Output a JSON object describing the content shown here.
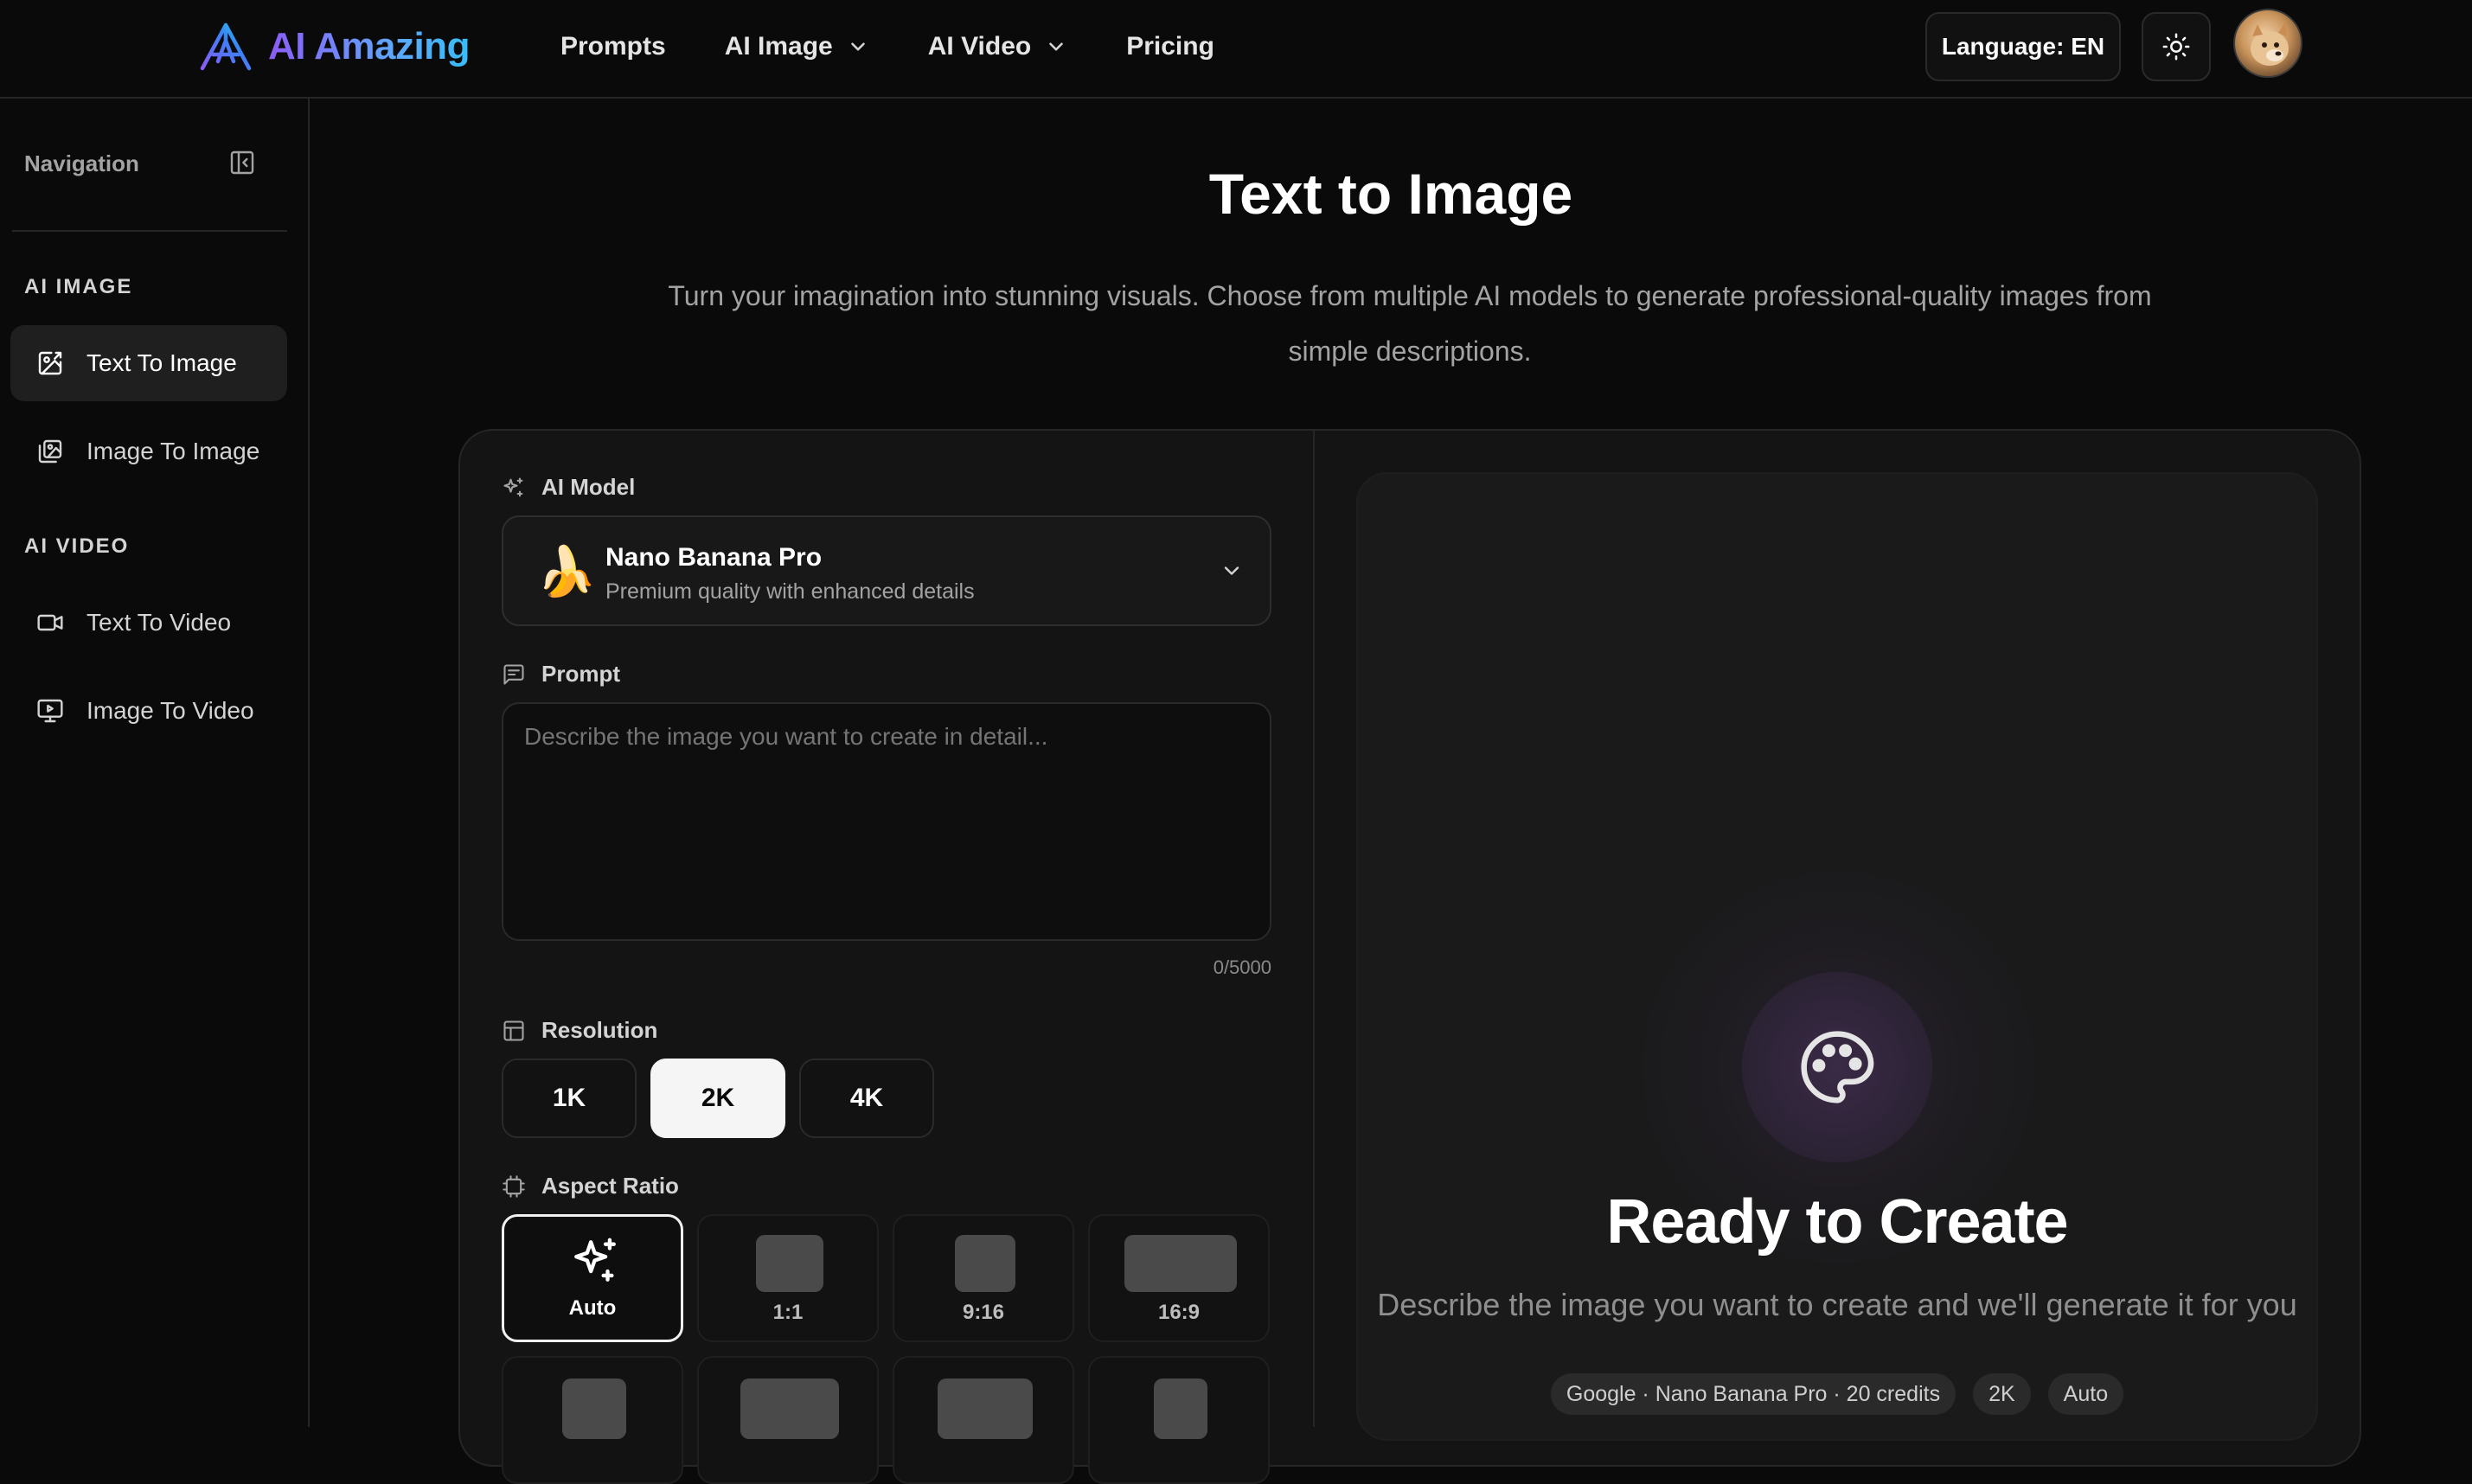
{
  "header": {
    "brand": "AI Amazing",
    "nav": [
      {
        "label": "Prompts",
        "has_dropdown": false
      },
      {
        "label": "AI Image",
        "has_dropdown": true
      },
      {
        "label": "AI Video",
        "has_dropdown": true
      },
      {
        "label": "Pricing",
        "has_dropdown": false
      }
    ],
    "language_button": "Language: EN",
    "theme_icon": "sun-icon",
    "avatar_icon": "user-avatar"
  },
  "sidebar": {
    "title": "Navigation",
    "collapse_icon": "sidebar-collapse-icon",
    "sections": [
      {
        "title": "AI IMAGE",
        "items": [
          {
            "label": "Text To Image",
            "icon": "image-edit-icon",
            "active": true
          },
          {
            "label": "Image To Image",
            "icon": "images-icon",
            "active": false
          }
        ]
      },
      {
        "title": "AI VIDEO",
        "items": [
          {
            "label": "Text To Video",
            "icon": "video-camera-icon",
            "active": false
          },
          {
            "label": "Image To Video",
            "icon": "monitor-play-icon",
            "active": false
          }
        ]
      }
    ]
  },
  "main": {
    "title": "Text to Image",
    "subtitle": "Turn your imagination into stunning visuals. Choose from multiple AI models to generate professional-quality images from simple descriptions."
  },
  "form": {
    "model_label": "AI Model",
    "model": {
      "name": "Nano Banana Pro",
      "description": "Premium quality with enhanced details",
      "emoji": "🍌"
    },
    "prompt_label": "Prompt",
    "prompt_placeholder": "Describe the image you want to create in detail...",
    "prompt_value": "",
    "char_count": "0/5000",
    "resolution_label": "Resolution",
    "resolutions": [
      {
        "label": "1K",
        "selected": false
      },
      {
        "label": "2K",
        "selected": true
      },
      {
        "label": "4K",
        "selected": false
      }
    ],
    "aspect_label": "Aspect Ratio",
    "aspect_ratios": [
      {
        "label": "Auto",
        "selected": true
      },
      {
        "label": "1:1",
        "selected": false
      },
      {
        "label": "9:16",
        "selected": false
      },
      {
        "label": "16:9",
        "selected": false
      }
    ]
  },
  "preview": {
    "icon": "palette-icon",
    "title": "Ready to Create",
    "subtitle": "Describe the image you want to create and we'll generate it for you",
    "chips": [
      "Google · Nano Banana Pro · 20 credits",
      "2K",
      "Auto"
    ]
  },
  "colors": {
    "background": "#0a0a0a",
    "panel": "#141414",
    "brand_gradient_start": "#8b5cf6",
    "brand_gradient_end": "#38bdf8",
    "selected_button": "#f5f5f5"
  }
}
